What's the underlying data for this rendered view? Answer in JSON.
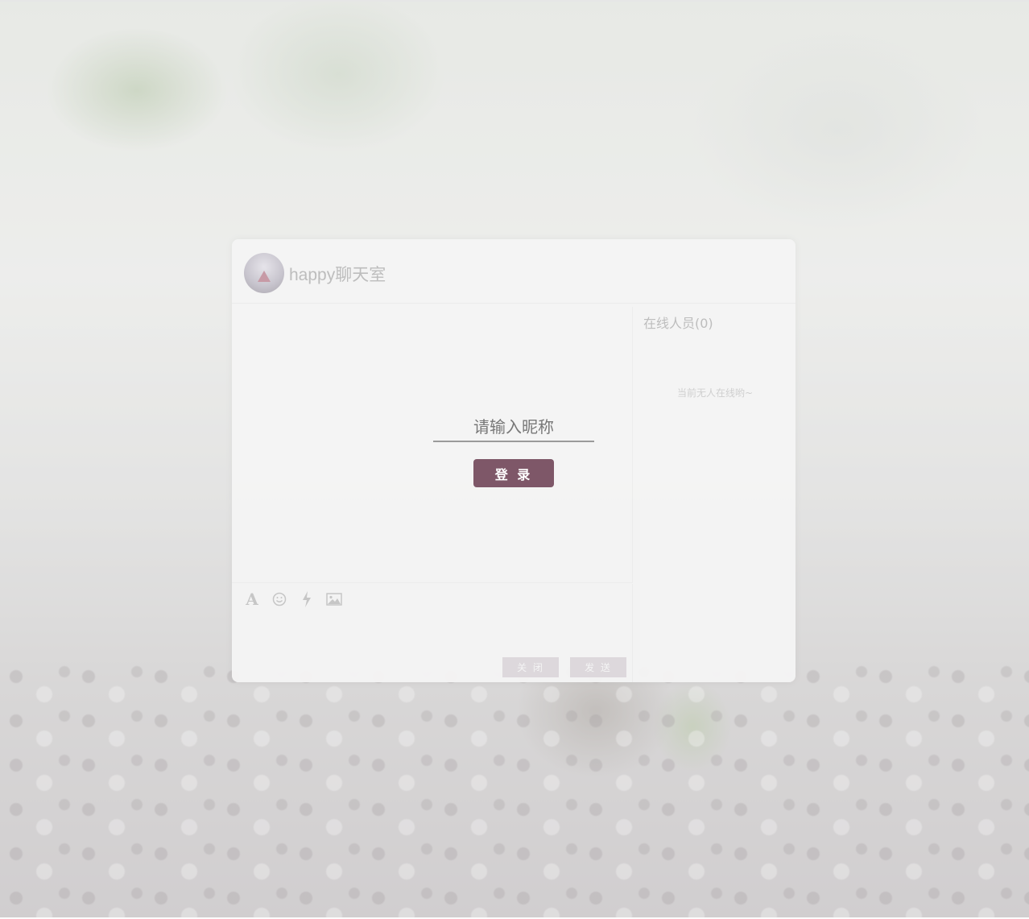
{
  "header": {
    "title": "happy聊天室",
    "avatar_icon": "chat-room-avatar"
  },
  "login": {
    "nickname_placeholder": "请输入昵称",
    "login_label": "登 录"
  },
  "toolbar": {
    "icons": [
      "font-icon",
      "emoji-icon",
      "flash-icon",
      "image-icon"
    ],
    "close_label": "关 闭",
    "send_label": "发 送"
  },
  "online": {
    "title": "在线人员(0)",
    "empty_text": "当前无人在线哟~"
  },
  "colors": {
    "accent": "#7e5768",
    "button_disabled": "#ddd8dc"
  }
}
